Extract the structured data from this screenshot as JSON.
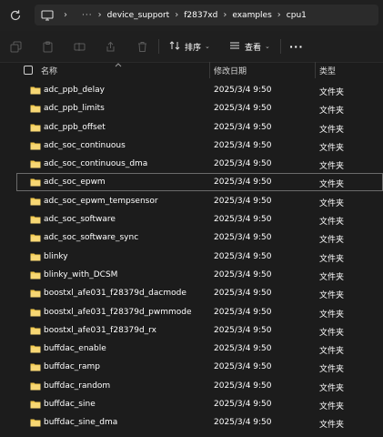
{
  "address_bar": {
    "overflow_label": "···",
    "breadcrumbs": [
      "device_support",
      "f2837xd",
      "examples",
      "cpu1"
    ]
  },
  "toolbar": {
    "sort_label": "排序",
    "view_label": "查看",
    "more_label": "···"
  },
  "columns": {
    "name": "名称",
    "modified": "修改日期",
    "type": "类型"
  },
  "colors": {
    "folder": "#f2c94c",
    "accent": "#4aa3e0"
  },
  "files": [
    {
      "name": "adc_ppb_delay",
      "date": "2025/3/4 9:50",
      "type": "文件夹"
    },
    {
      "name": "adc_ppb_limits",
      "date": "2025/3/4 9:50",
      "type": "文件夹"
    },
    {
      "name": "adc_ppb_offset",
      "date": "2025/3/4 9:50",
      "type": "文件夹"
    },
    {
      "name": "adc_soc_continuous",
      "date": "2025/3/4 9:50",
      "type": "文件夹"
    },
    {
      "name": "adc_soc_continuous_dma",
      "date": "2025/3/4 9:50",
      "type": "文件夹"
    },
    {
      "name": "adc_soc_epwm",
      "date": "2025/3/4 9:50",
      "type": "文件夹",
      "selected": true
    },
    {
      "name": "adc_soc_epwm_tempsensor",
      "date": "2025/3/4 9:50",
      "type": "文件夹"
    },
    {
      "name": "adc_soc_software",
      "date": "2025/3/4 9:50",
      "type": "文件夹"
    },
    {
      "name": "adc_soc_software_sync",
      "date": "2025/3/4 9:50",
      "type": "文件夹"
    },
    {
      "name": "blinky",
      "date": "2025/3/4 9:50",
      "type": "文件夹"
    },
    {
      "name": "blinky_with_DCSM",
      "date": "2025/3/4 9:50",
      "type": "文件夹"
    },
    {
      "name": "boostxl_afe031_f28379d_dacmode",
      "date": "2025/3/4 9:50",
      "type": "文件夹"
    },
    {
      "name": "boostxl_afe031_f28379d_pwmmode",
      "date": "2025/3/4 9:50",
      "type": "文件夹"
    },
    {
      "name": "boostxl_afe031_f28379d_rx",
      "date": "2025/3/4 9:50",
      "type": "文件夹"
    },
    {
      "name": "buffdac_enable",
      "date": "2025/3/4 9:50",
      "type": "文件夹"
    },
    {
      "name": "buffdac_ramp",
      "date": "2025/3/4 9:50",
      "type": "文件夹"
    },
    {
      "name": "buffdac_random",
      "date": "2025/3/4 9:50",
      "type": "文件夹"
    },
    {
      "name": "buffdac_sine",
      "date": "2025/3/4 9:50",
      "type": "文件夹"
    },
    {
      "name": "buffdac_sine_dma",
      "date": "2025/3/4 9:50",
      "type": "文件夹"
    }
  ]
}
